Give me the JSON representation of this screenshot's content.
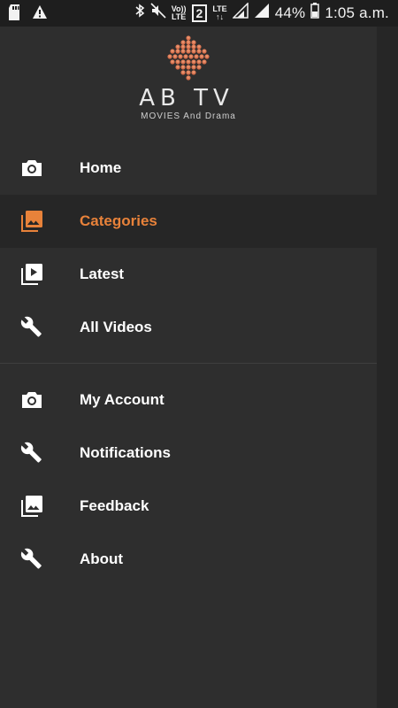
{
  "status_bar": {
    "battery": "44%",
    "time": "1:05 a.m.",
    "sim_slot": "2",
    "volte": [
      "Vo))",
      "LTE"
    ],
    "lte": "LTE",
    "icons": [
      "sd-card-icon",
      "warning-icon",
      "bluetooth-icon",
      "mute-icon",
      "signal-icon",
      "signal-icon",
      "battery-icon"
    ]
  },
  "drawer": {
    "logo": {
      "title": "AB TV",
      "tagline": "MOVIES And Drama"
    },
    "primary_items": [
      {
        "label": "Home",
        "icon": "camera-icon"
      },
      {
        "label": "Categories",
        "icon": "photo-library-icon",
        "active": true
      },
      {
        "label": "Latest",
        "icon": "video-library-icon"
      },
      {
        "label": "All Videos",
        "icon": "wrench-icon"
      }
    ],
    "secondary_items": [
      {
        "label": "My Account",
        "icon": "camera-icon"
      },
      {
        "label": "Notifications",
        "icon": "wrench-icon"
      },
      {
        "label": "Feedback",
        "icon": "photo-library-icon"
      },
      {
        "label": "About",
        "icon": "wrench-icon"
      }
    ]
  },
  "colors": {
    "accent": "#e8823a",
    "drawer_bg": "#2e2e2e",
    "active_bg": "#262626"
  }
}
